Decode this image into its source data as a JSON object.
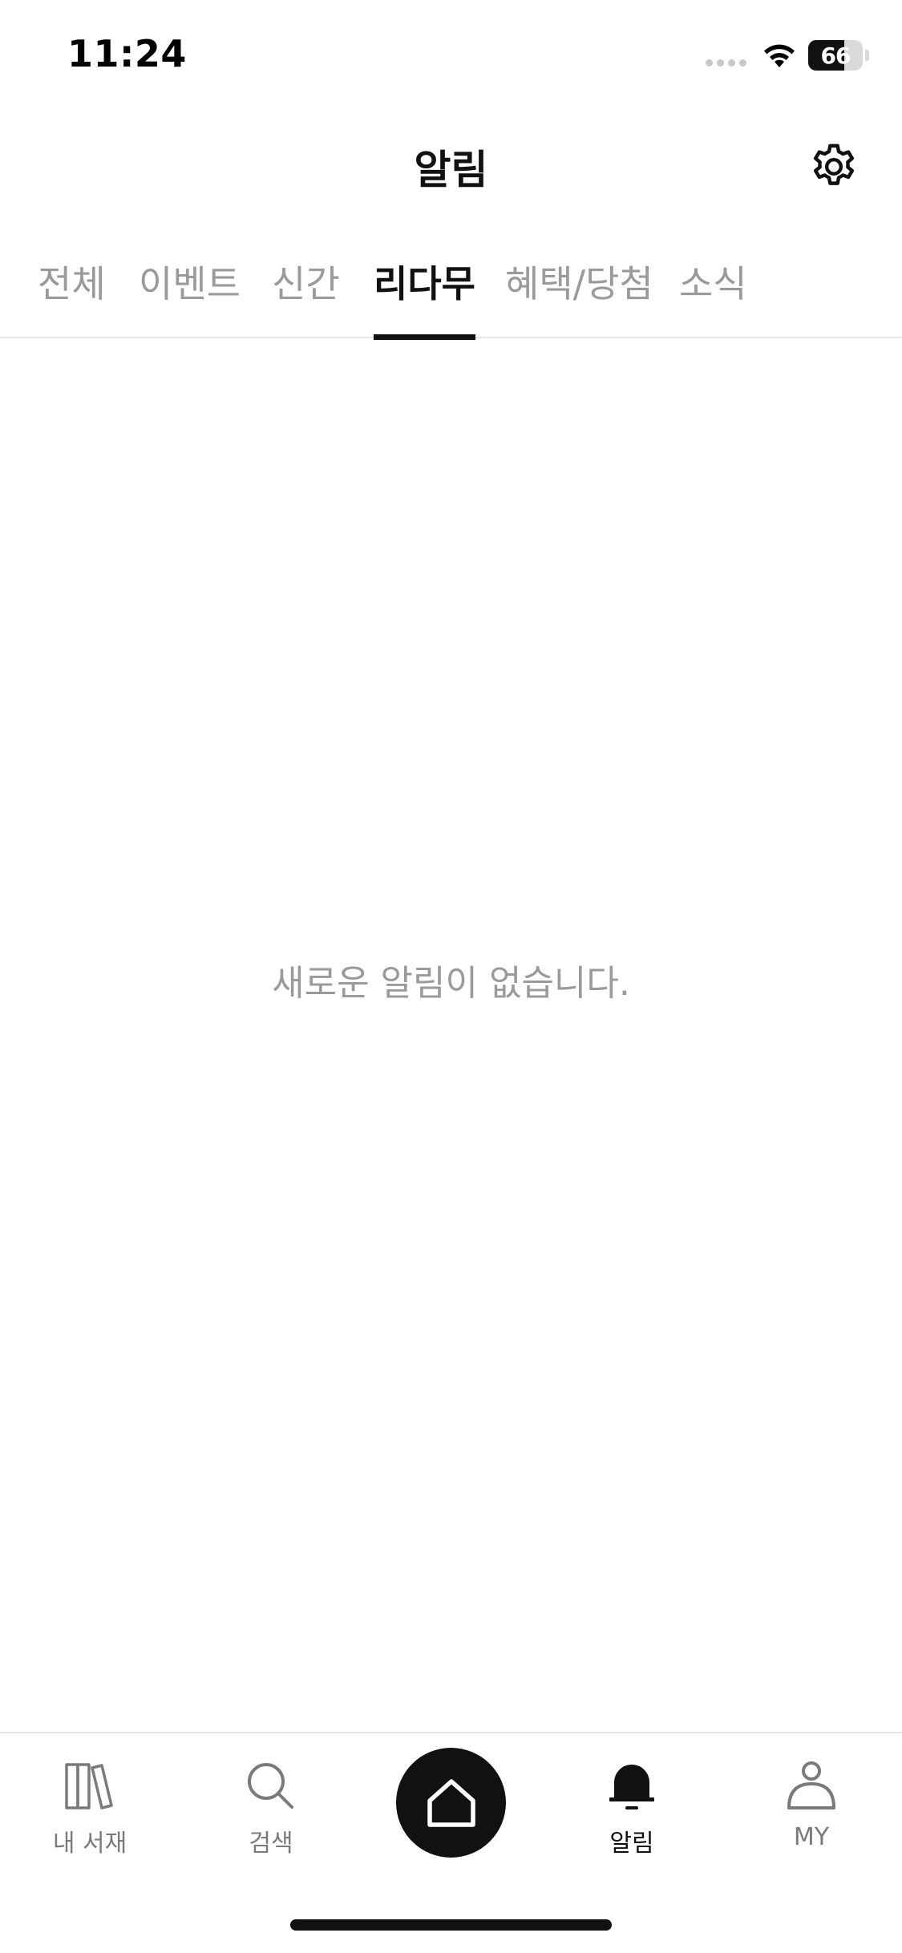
{
  "status_bar": {
    "time": "11:24",
    "battery_percent": "66",
    "battery_level": 0.66
  },
  "header": {
    "title": "알림",
    "settings_icon": "gear-icon"
  },
  "tabs": [
    {
      "label": "전체",
      "active": false
    },
    {
      "label": "이벤트",
      "active": false
    },
    {
      "label": "신간",
      "active": false
    },
    {
      "label": "리다무",
      "active": true
    },
    {
      "label": "혜택/당첨",
      "active": false
    },
    {
      "label": "소식",
      "active": false
    }
  ],
  "empty_state": {
    "message": "새로운 알림이 없습니다."
  },
  "bottom_nav": {
    "items": [
      {
        "label": "내 서재",
        "icon": "library-icon",
        "active": false
      },
      {
        "label": "검색",
        "icon": "search-icon",
        "active": false
      },
      {
        "label": "",
        "icon": "home-icon",
        "active": false
      },
      {
        "label": "알림",
        "icon": "bell-icon",
        "active": true
      },
      {
        "label": "MY",
        "icon": "user-icon",
        "active": false
      }
    ]
  },
  "colors": {
    "text_primary": "#111111",
    "text_secondary": "#9a9a9a",
    "divider": "#e6e6e6",
    "background": "#ffffff"
  }
}
